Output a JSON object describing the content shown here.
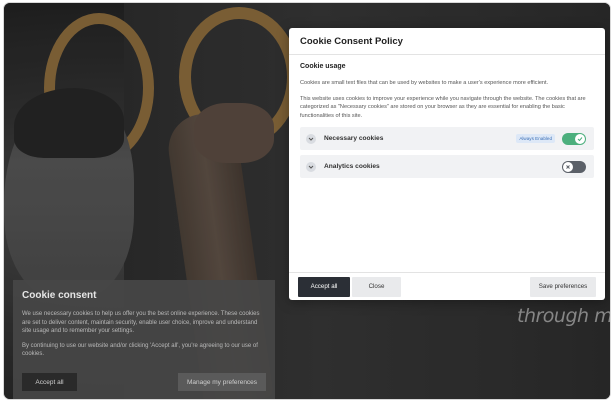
{
  "background": {
    "tagline": "through my"
  },
  "banner": {
    "title": "Cookie consent",
    "text1": "We use necessary cookies to help us offer you the best online experience. These cookies are set to deliver content, maintain security, enable user choice, improve and understand site usage and to remember your settings.",
    "text2": "By continuing to use our website and/or clicking 'Accept all', you're agreeing to our use of cookies.",
    "accept_label": "Accept all",
    "manage_label": "Manage my preferences"
  },
  "modal": {
    "title": "Cookie Consent Policy",
    "section_title": "Cookie usage",
    "para1": "Cookies are small text files that can be used by websites to make a user's experience more efficient.",
    "para2": "This website uses cookies to improve your experience while you navigate through the website. The cookies that are categorized as \"Necessary cookies\" are stored on your browser as they are essential for enabling the basic functionalities of this site.",
    "categories": [
      {
        "label": "Necessary cookies",
        "badge": "Always Enabled",
        "enabled": true,
        "icon": "chevron-down-icon"
      },
      {
        "label": "Analytics cookies",
        "badge": "",
        "enabled": false,
        "icon": "chevron-down-icon"
      }
    ],
    "footer": {
      "accept_label": "Accept all",
      "close_label": "Close",
      "save_label": "Save preferences"
    }
  },
  "colors": {
    "toggle_on": "#4caf7d",
    "toggle_off": "#5b6068",
    "badge_text": "#3b6fb6",
    "primary_button": "#2b2f36"
  }
}
